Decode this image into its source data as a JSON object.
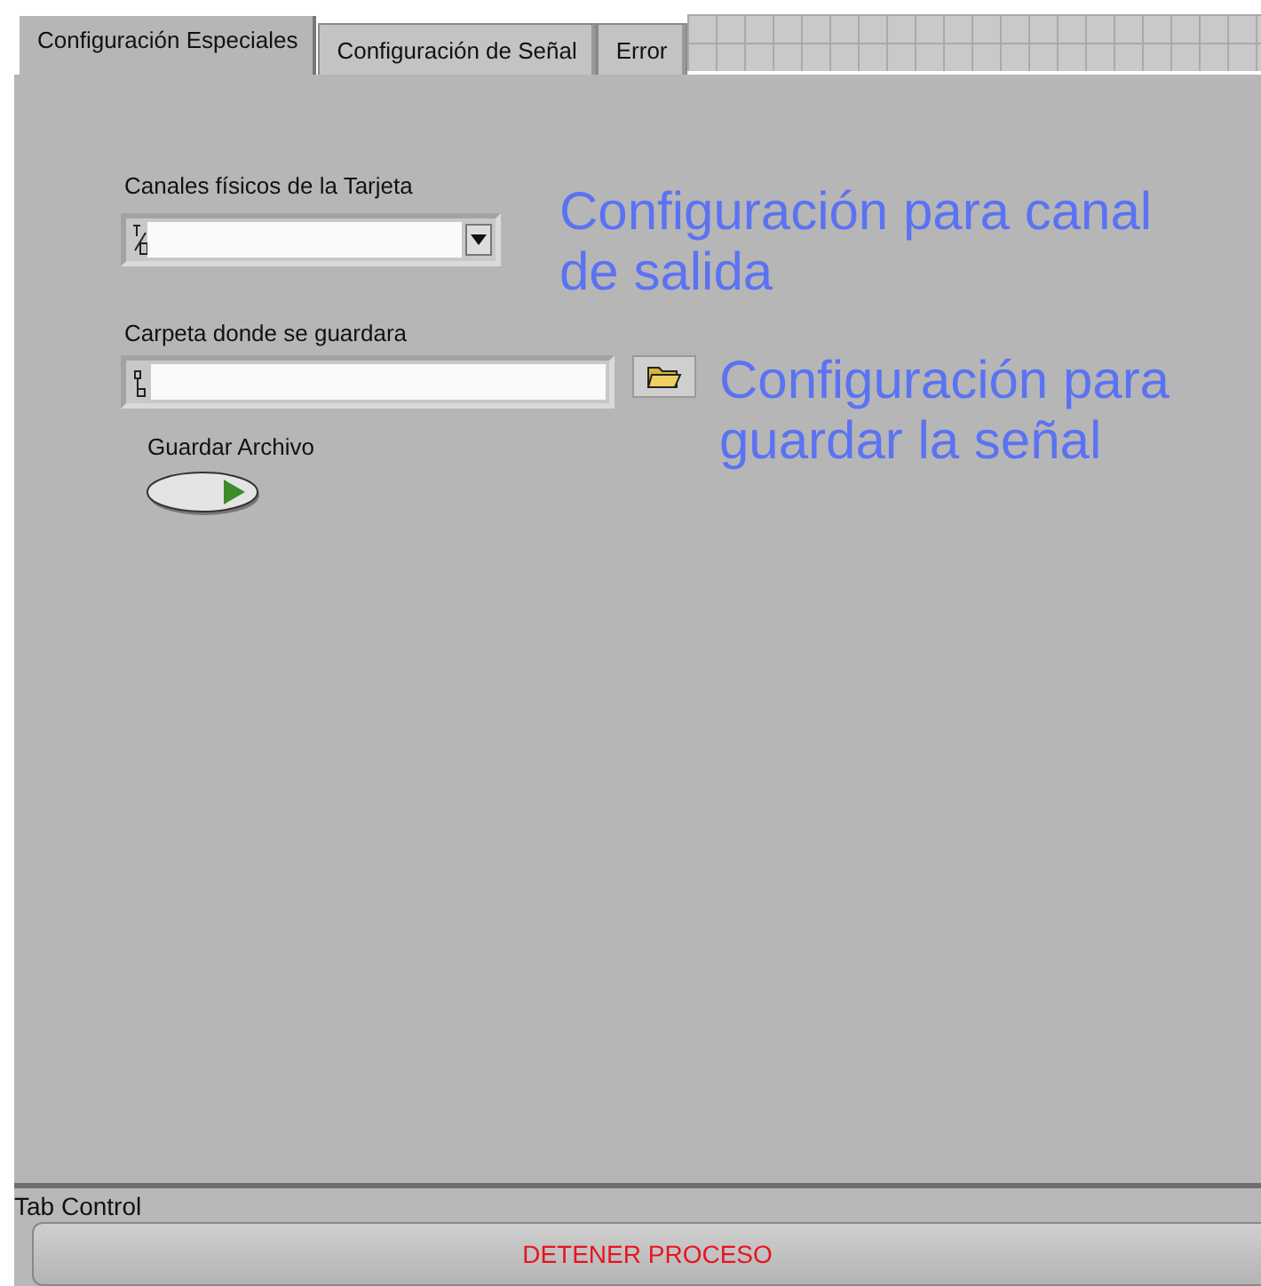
{
  "tabs": [
    {
      "label": "Configuración Especiales",
      "selected": true
    },
    {
      "label": "Configuración de Señal",
      "selected": false
    },
    {
      "label": "Error",
      "selected": false
    }
  ],
  "panel": {
    "controls": [
      {
        "kind": "ring",
        "label": "Canales físicos de la Tarjeta"
      },
      {
        "kind": "path",
        "label": "Carpeta donde se guardara"
      },
      {
        "kind": "toggle",
        "label": "Guardar Archivo"
      }
    ],
    "notes": [
      "Configuración para canal de salida",
      "Configuración para guardar la señal"
    ]
  },
  "tab_control_label": "Tab Control",
  "stop_button": "DETENER PROCESO"
}
